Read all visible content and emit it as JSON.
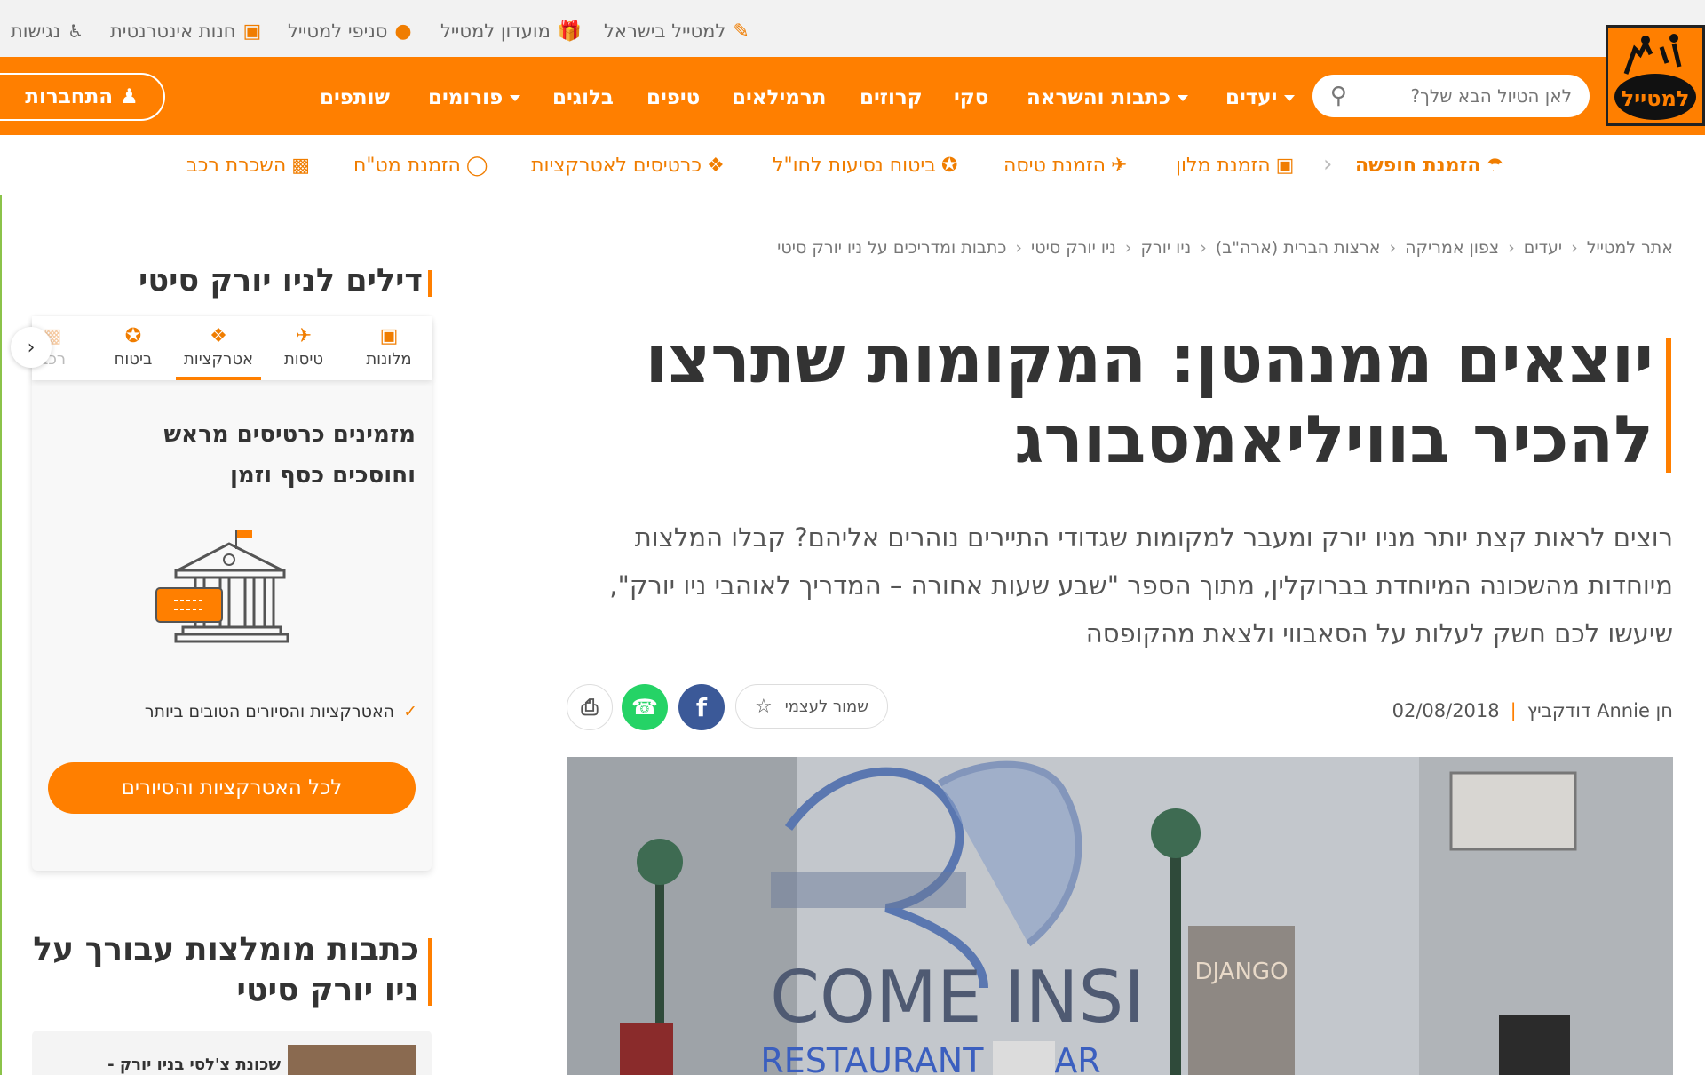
{
  "util": {
    "israel": "למטייל בישראל",
    "club": "מועדון למטייל",
    "branches": "סניפי למטייל",
    "shop": "חנות אינטרנטית",
    "access": "נגישות"
  },
  "logo": {
    "text": "למטייל"
  },
  "nav": {
    "search_placeholder": "לאן הטיול הבא שלך?",
    "items": [
      "יעדים",
      "כתבות והשראה",
      "סקי",
      "קרוזים",
      "תרמילאים",
      "טיפים",
      "בלוגים",
      "פורומים",
      "שותפים"
    ],
    "login": "התחברות"
  },
  "booking": {
    "items": [
      "הזמנת חופשה",
      "הזמנת מלון",
      "הזמנת טיסה",
      "ביטוח נסיעות לחו\"ל",
      "כרטיסים לאטרקציות",
      "הזמנת מט\"ח",
      "השכרת רכב"
    ]
  },
  "breadcrumb": [
    "אתר למטייל",
    "יעדים",
    "צפון אמריקה",
    "ארצות הברית (ארה\"ב)",
    "ניו יורק",
    "ניו יורק סיטי",
    "כתבות ומדריכים על ניו יורק סיטי"
  ],
  "article": {
    "title": "יוצאים ממנהטן: המקומות שתרצו להכיר בוויליאמסבורג",
    "lead": "רוצים לראות קצת יותר מניו יורק ומעבר למקומות שגדודי התיירים נוהרים אליהם? קבלו המלצות מיוחדות מהשכונה המיוחדת בברוקלין, מתוך הספר \"שבע שעות אחורה – המדריך לאוהבי ניו יורק\", שיעשו לכם חשק לעלות על הסאבווי ולצאת מהקופסה",
    "author": "חן Annie דודקביץ",
    "date": "02/08/2018",
    "save": "שמור לעצמי",
    "hero_sign_1": "COME INSI",
    "hero_sign_2": "RESTAURANT & BAR",
    "hero_sign_3": "DJANGO"
  },
  "sidebar": {
    "deals_title": "דילים לניו יורק סיטי",
    "tabs": [
      "מלונות",
      "טיסות",
      "אטרקציות",
      "ביטוח",
      "רכב"
    ],
    "promo": "מזמינים כרטיסים מראש וחוסכים כסף וזמן",
    "check": "האטרקציות והסיורים הטובים ביותר",
    "cta": "לכל האטרקציות והסיורים",
    "rec_title": "כתבות מומלצות עבורך על ניו יורק סיטי",
    "rec_card": "שכונת צ'לסי בניו יורק -"
  },
  "colors": {
    "brand": "#ff7f00",
    "facebook": "#3b5998",
    "whatsapp": "#25d366"
  }
}
